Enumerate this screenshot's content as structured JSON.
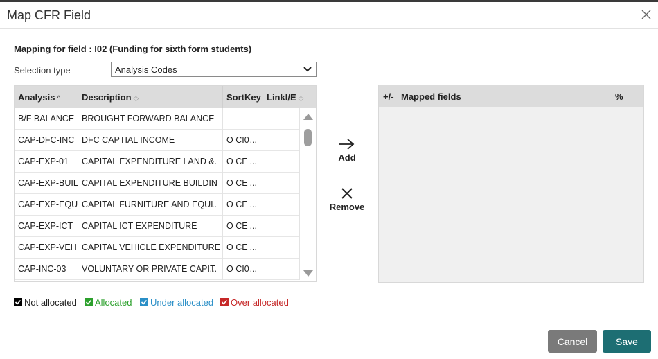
{
  "dialog": {
    "title": "Map CFR Field"
  },
  "mapping_label": "Mapping for field : I02 (Funding for sixth form students)",
  "selection": {
    "label": "Selection type",
    "value": "Analysis Codes"
  },
  "grid": {
    "columns": [
      "Analysis",
      "Description",
      "SortKey",
      "LinkI/E"
    ],
    "rows": [
      {
        "analysis": "B/F BALANCE",
        "description": "BROUGHT FORWARD BALANCE",
        "sortkey": ""
      },
      {
        "analysis": "CAP-DFC-INC",
        "description": "DFC CAPTIAL INCOME",
        "sortkey": "O CI0"
      },
      {
        "analysis": "CAP-EXP-01",
        "description": "CAPITAL EXPENDITURE LAND &",
        "sortkey": "O CE"
      },
      {
        "analysis": "CAP-EXP-BUIL",
        "description": "CAPITAL EXPENDITURE BUILDIN",
        "sortkey": "O CE"
      },
      {
        "analysis": "CAP-EXP-EQU",
        "description": "CAPITAL FURNITURE AND EQUI",
        "sortkey": "O CE"
      },
      {
        "analysis": "CAP-EXP-ICT",
        "description": "CAPITAL ICT EXPENDITURE",
        "sortkey": "O CE"
      },
      {
        "analysis": "CAP-EXP-VEH",
        "description": "CAPITAL VEHICLE EXPENDITURE",
        "sortkey": "O CE"
      },
      {
        "analysis": "CAP-INC-03",
        "description": "VOLUNTARY OR PRIVATE CAPIT",
        "sortkey": "O CI0"
      }
    ]
  },
  "actions": {
    "add": "Add",
    "remove": "Remove"
  },
  "mapped": {
    "col_toggle": "+/-",
    "col_fields": "Mapped fields",
    "col_pct": "%"
  },
  "legend": [
    {
      "label": "Not allocated",
      "color": "#000000"
    },
    {
      "label": "Allocated",
      "color": "#2ca02c"
    },
    {
      "label": "Under allocated",
      "color": "#2a8fc7"
    },
    {
      "label": "Over allocated",
      "color": "#c62828"
    }
  ],
  "footer": {
    "cancel": "Cancel",
    "save": "Save"
  },
  "colors": {
    "save_button": "#1d6e73",
    "cancel_button": "#7a7a7a",
    "header_bg": "#dcdcdc"
  }
}
